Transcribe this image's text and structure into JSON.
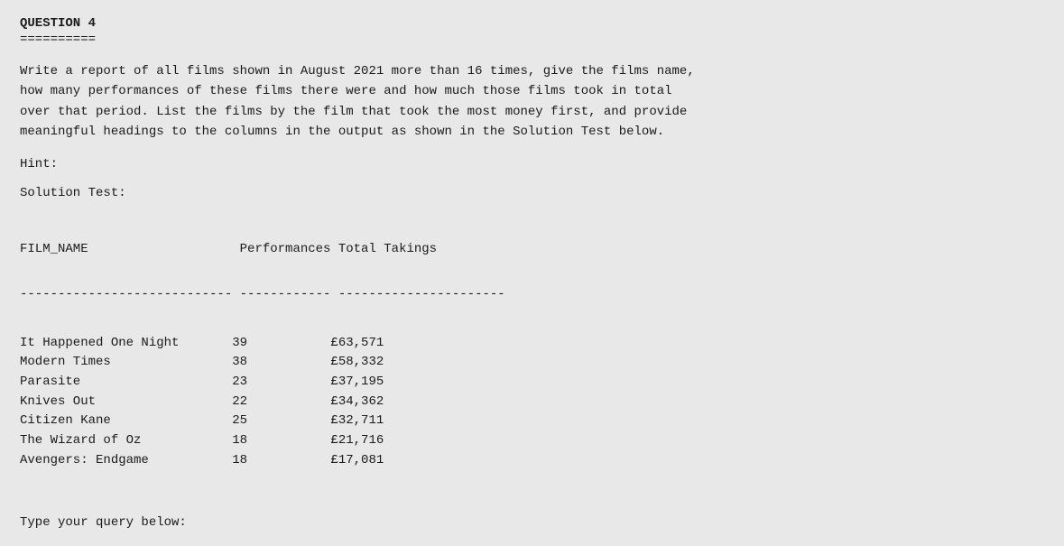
{
  "question": {
    "title": "QUESTION 4",
    "separator": "==========",
    "description_lines": [
      "Write a report of all films shown in August 2021 more than 16 times, give the films name,",
      "how many performances of these films there were and how much those films took in total",
      "over that period. List the films by the film that took the most money first, and provide",
      "meaningful headings to the columns in the output as shown in the Solution Test below."
    ],
    "hint_label": "Hint:",
    "solution_label": "Solution Test:",
    "table": {
      "header": "FILM_NAME                    Performances Total Takings",
      "divider": "---------------------------- ------------ ----------------------",
      "rows": [
        {
          "film": "It Happened One Night",
          "performances": "39",
          "takings": "£63,571"
        },
        {
          "film": "Modern Times",
          "performances": "38",
          "takings": "£58,332"
        },
        {
          "film": "Parasite",
          "performances": "23",
          "takings": "£37,195"
        },
        {
          "film": "Knives Out",
          "performances": "22",
          "takings": "£34,362"
        },
        {
          "film": "Citizen Kane",
          "performances": "25",
          "takings": "£32,711"
        },
        {
          "film": "The Wizard of Oz",
          "performances": "18",
          "takings": "£21,716"
        },
        {
          "film": "Avengers: Endgame",
          "performances": "18",
          "takings": "£17,081"
        }
      ]
    },
    "type_query": "Type your query below:"
  }
}
